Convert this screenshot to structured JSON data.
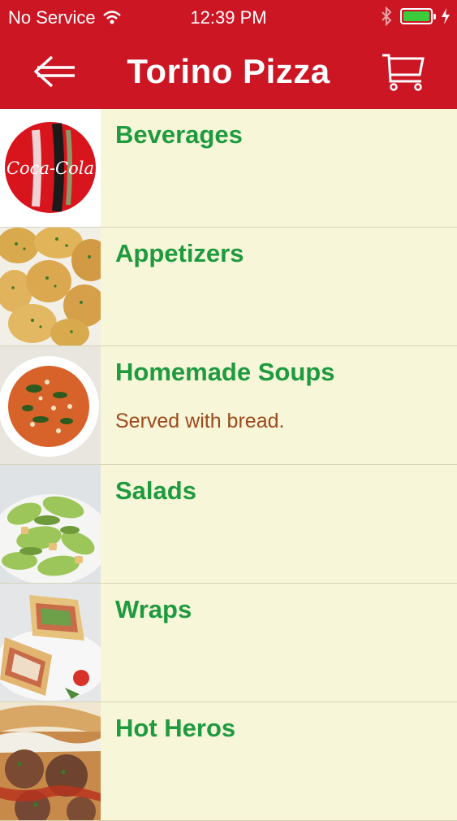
{
  "status": {
    "carrier": "No Service",
    "time": "12:39 PM",
    "battery_level": 1.0
  },
  "nav": {
    "title": "Torino Pizza",
    "back_icon": "arrow-left-icon",
    "cart_icon": "cart-icon"
  },
  "categories": [
    {
      "title": "Beverages",
      "description": "",
      "image": "coca-cola-logo-image"
    },
    {
      "title": "Appetizers",
      "description": "",
      "image": "garlic-knots-image"
    },
    {
      "title": "Homemade Soups",
      "description": "Served with bread.",
      "image": "soup-bowl-image"
    },
    {
      "title": "Salads",
      "description": "",
      "image": "caesar-salad-image"
    },
    {
      "title": "Wraps",
      "description": "",
      "image": "wrap-sandwich-image"
    },
    {
      "title": "Hot Heros",
      "description": "",
      "image": "meatball-hero-image"
    }
  ],
  "colors": {
    "header": "#cc1624",
    "list_background": "#f8f6d8",
    "category_title": "#1e9a3f",
    "category_description": "#9b4a1c",
    "battery": "#3ccb3c"
  },
  "logo_text": "Coca-Cola"
}
